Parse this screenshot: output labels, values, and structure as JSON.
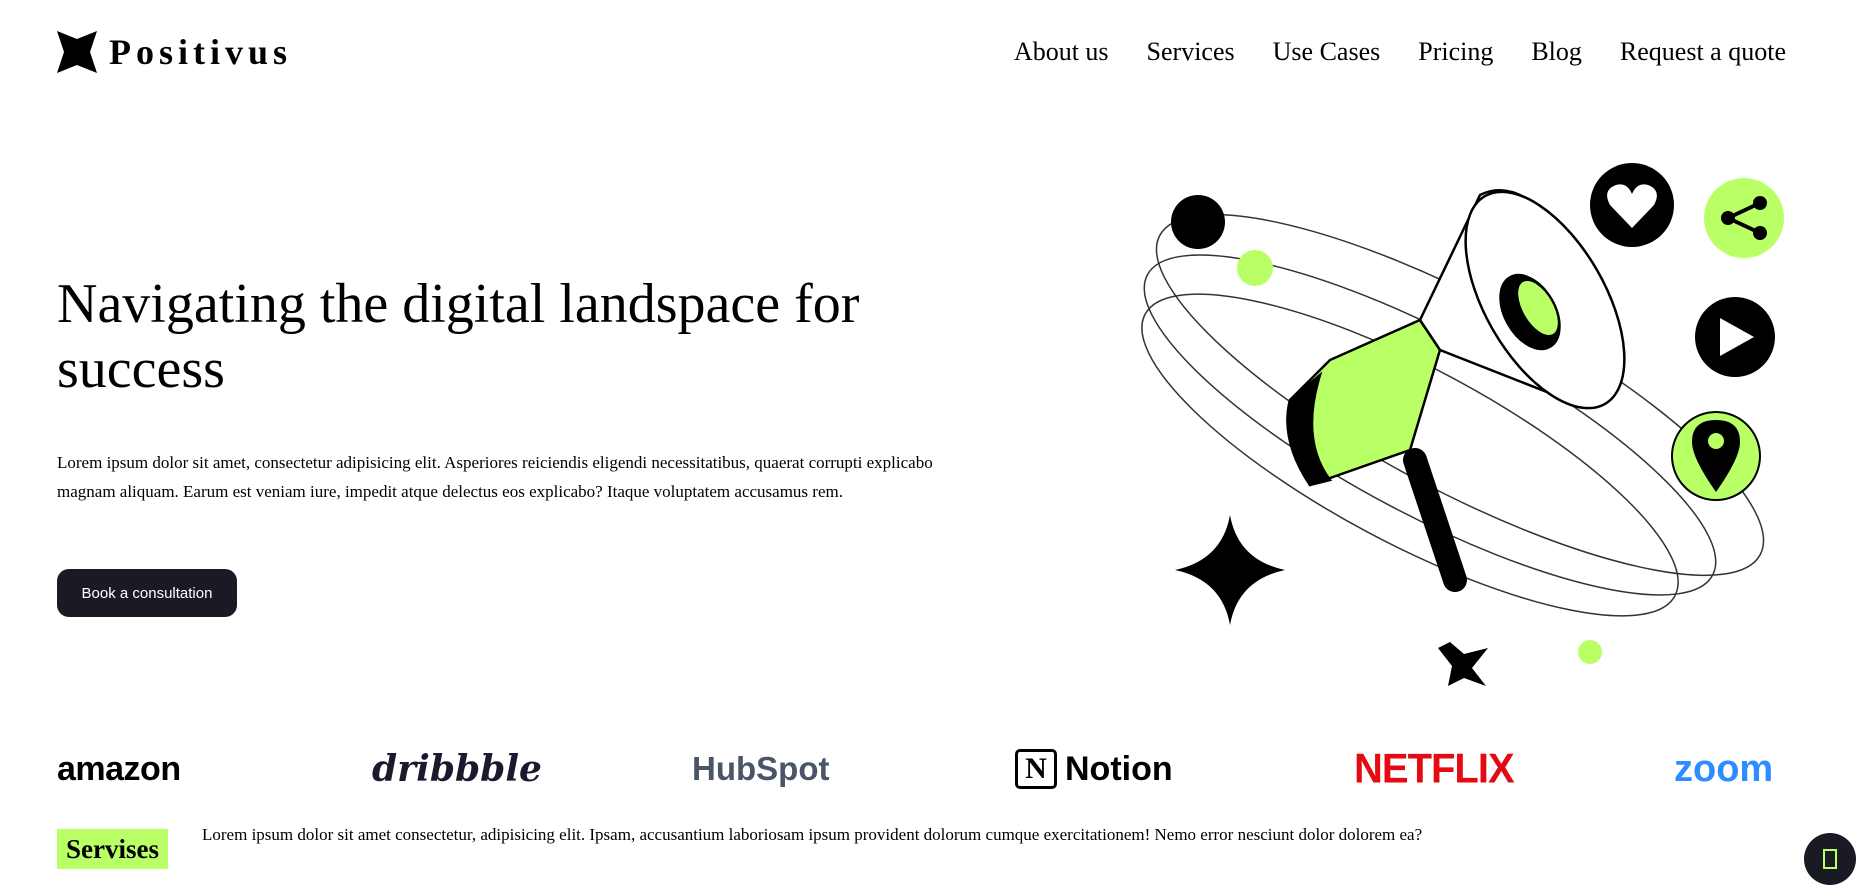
{
  "brand": {
    "name": "Positivus",
    "accent": "#b9ff66",
    "dark": "#191a23"
  },
  "nav": {
    "items": [
      {
        "label": "About us",
        "key": "about-us"
      },
      {
        "label": "Services",
        "key": "services"
      },
      {
        "label": "Use Cases",
        "key": "use-cases"
      },
      {
        "label": "Pricing",
        "key": "pricing"
      },
      {
        "label": "Blog",
        "key": "blog"
      },
      {
        "label": "Request a quote",
        "key": "request-a-quote"
      }
    ]
  },
  "hero": {
    "title": "Navigating the digital landspace for success",
    "text": "Lorem ipsum dolor sit amet, consectetur adipisicing elit. Asperiores reiciendis eligendi necessitatibus, quaerat corrupti explicabo magnam aliquam. Earum est veniam iure, impedit atque delectus eos explicabo? Itaque voluptatem accusamus rem.",
    "cta_label": "Book a consultation",
    "illustration_icons": [
      "megaphone-icon",
      "heart-icon",
      "share-icon",
      "play-icon",
      "location-pin-icon",
      "sparkle-star-icon"
    ]
  },
  "logos": {
    "amazon": "amazon",
    "dribbble": "dribbble",
    "hubspot": "HubSpot",
    "notion": "Notion",
    "notion_mark": "N",
    "netflix": "NETFLIX",
    "zoom": "zoom"
  },
  "services": {
    "tag": "Servises",
    "text": "Lorem ipsum dolor sit amet consectetur, adipisicing elit. Ipsam, accusantium laboriosam ipsum provident dolorum cumque exercitationem! Nemo error nesciunt dolor dolorem ea?"
  },
  "chat": {
    "icon": "chat-icon"
  }
}
